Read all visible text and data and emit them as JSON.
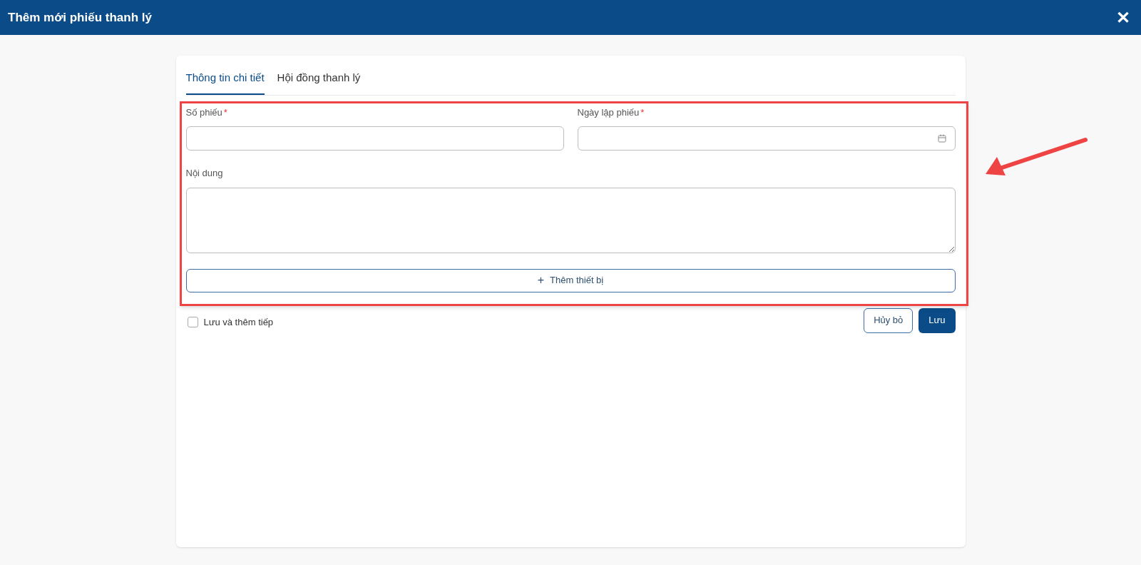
{
  "window": {
    "title": "Thêm mới phiếu thanh lý",
    "close": "✕"
  },
  "tabs": [
    {
      "label": "Thông tin chi tiết",
      "selected": true
    },
    {
      "label": "Hội đồng thanh lý",
      "selected": false
    }
  ],
  "form": {
    "fields": [
      {
        "kind": "text",
        "label": "Số phiếu",
        "mark": "*"
      },
      {
        "kind": "date",
        "label": "Ngày lập phiếu",
        "mark": "*"
      },
      {
        "kind": "textarea",
        "label": "Nội dung"
      }
    ],
    "add_button": {
      "icon": "+",
      "label": "Thêm thiết bị"
    }
  },
  "save_and_continue": {
    "label": "Lưu và thêm tiếp",
    "checked": false
  },
  "buttons": [
    {
      "kind": "secondary",
      "label": "Hủy bỏ"
    },
    {
      "kind": "primary",
      "label": "Lưu"
    }
  ]
}
